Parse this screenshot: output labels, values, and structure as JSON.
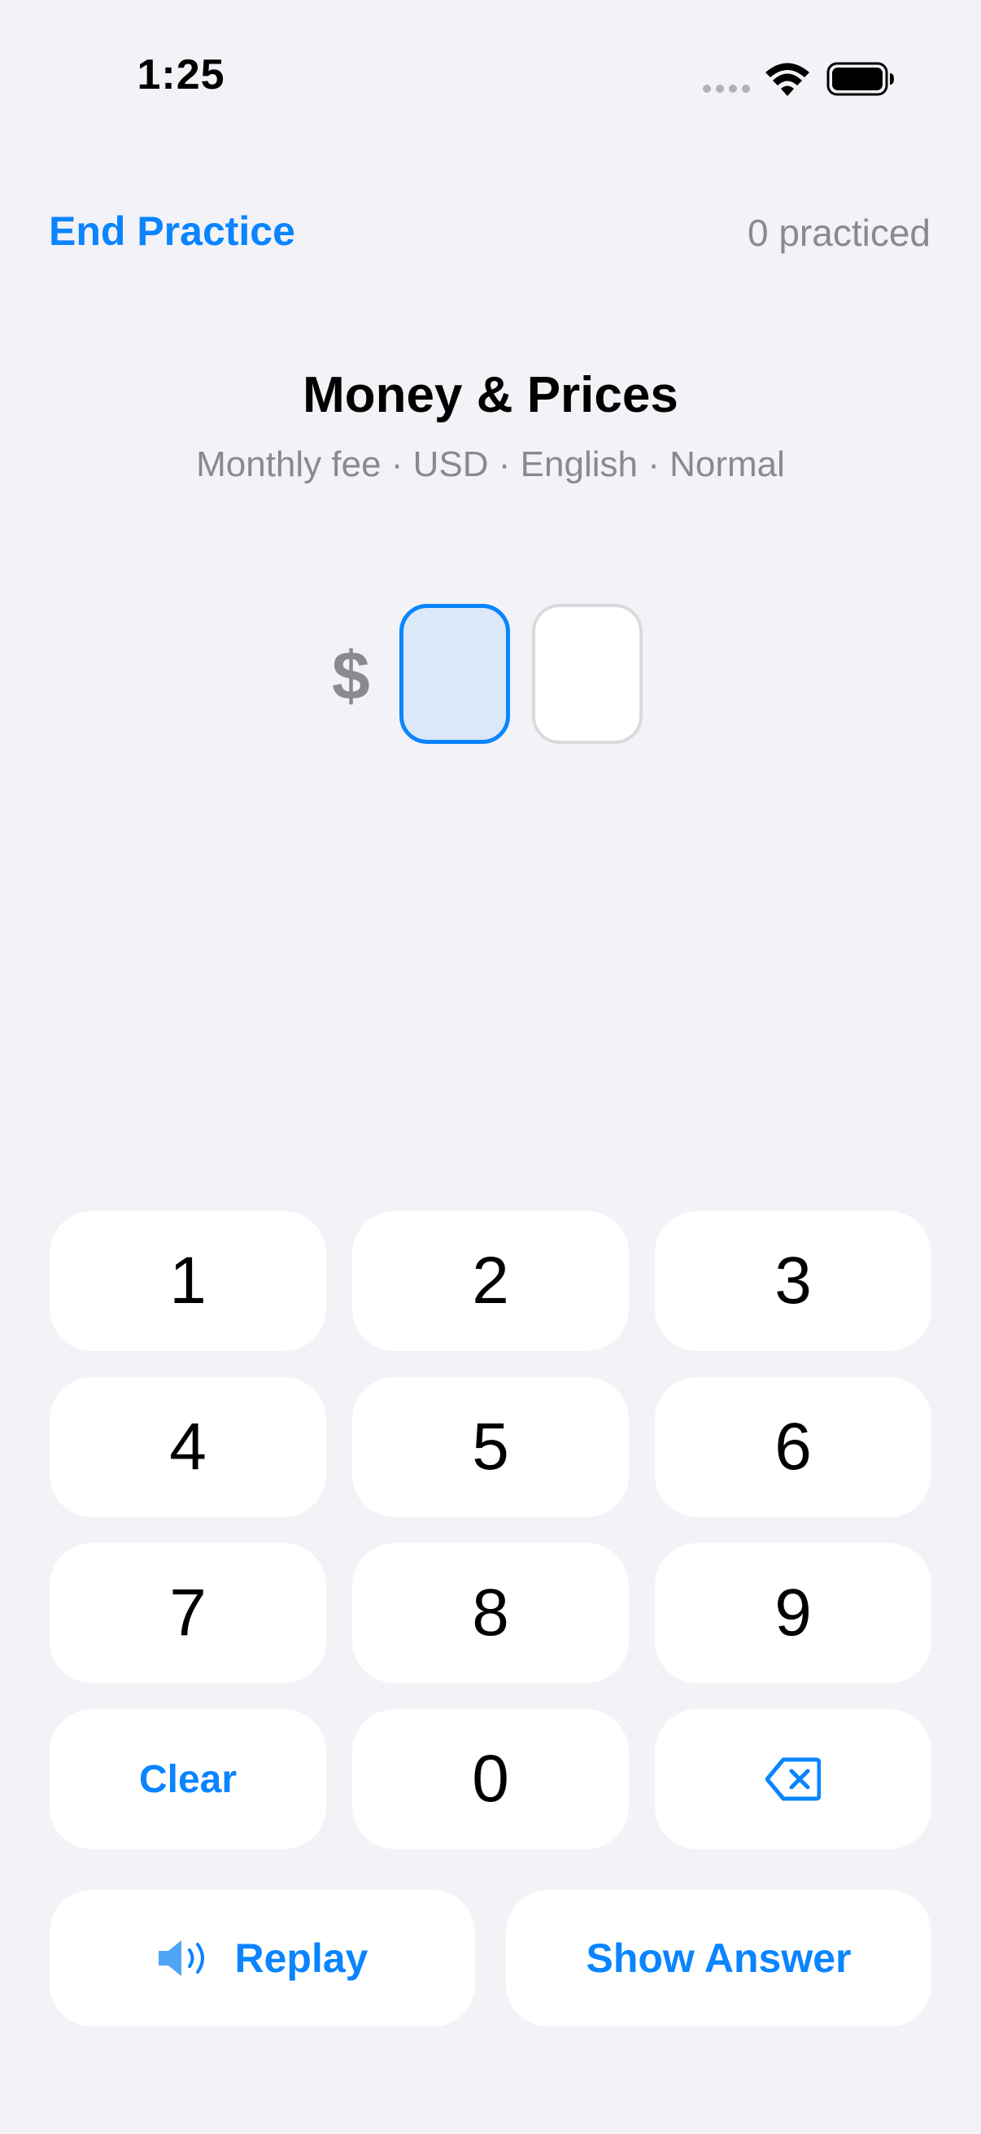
{
  "status": {
    "time": "1:25"
  },
  "nav": {
    "end_practice": "End Practice",
    "practiced_count": "0 practiced"
  },
  "exercise": {
    "title": "Money & Prices",
    "subtitle": "Monthly fee · USD · English · Normal",
    "currency_symbol": "$"
  },
  "keypad": {
    "keys": [
      "1",
      "2",
      "3",
      "4",
      "5",
      "6",
      "7",
      "8",
      "9"
    ],
    "clear": "Clear",
    "zero": "0",
    "backspace_icon": "delete-left-icon"
  },
  "actions": {
    "replay": "Replay",
    "replay_icon": "speaker-icon",
    "show_answer": "Show Answer"
  },
  "colors": {
    "accent": "#0A84FF",
    "background": "#F2F2F7",
    "secondary_text": "#8A8A8E",
    "active_box_fill": "#DCE8F7"
  }
}
